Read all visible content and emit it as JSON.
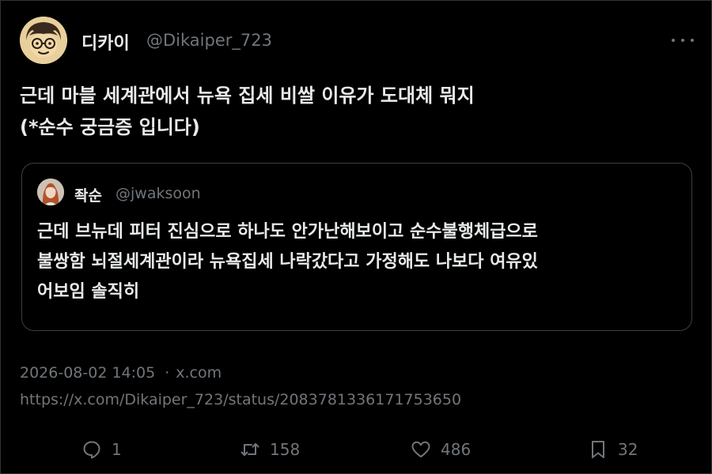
{
  "author": {
    "display_name": "디카이",
    "handle": "@Dikaiper_723",
    "avatar_icon": "cartoon-avatar-icon"
  },
  "tweet": {
    "lines": [
      "근데 마블 세계관에서 뉴욕 집세 비쌀 이유가 도대체 뭐지",
      "(*순수 궁금증 입니다)"
    ]
  },
  "quoted": {
    "display_name": "좍순",
    "handle": "@jwaksoon",
    "lines": [
      "근데 브뉴데 피터 진심으로 하나도 안가난해보이고 순수불행체급으로",
      "불쌍함 뇌절세계관이라 뉴욕집세 나락갔다고 가정해도 나보다 여유있",
      "어보임 솔직히"
    ]
  },
  "meta": {
    "timestamp": "2026-08-02 14:05",
    "separator": "·",
    "source": "x.com",
    "url": "https://x.com/Dikaiper_723/status/2083781336171753650"
  },
  "actions": {
    "reply_count": "1",
    "retweet_count": "158",
    "like_count": "486",
    "bookmark_count": "32"
  },
  "colors": {
    "background": "#000000",
    "text": "#e7e9ea",
    "muted": "#71767b",
    "border": "#2f3336"
  }
}
